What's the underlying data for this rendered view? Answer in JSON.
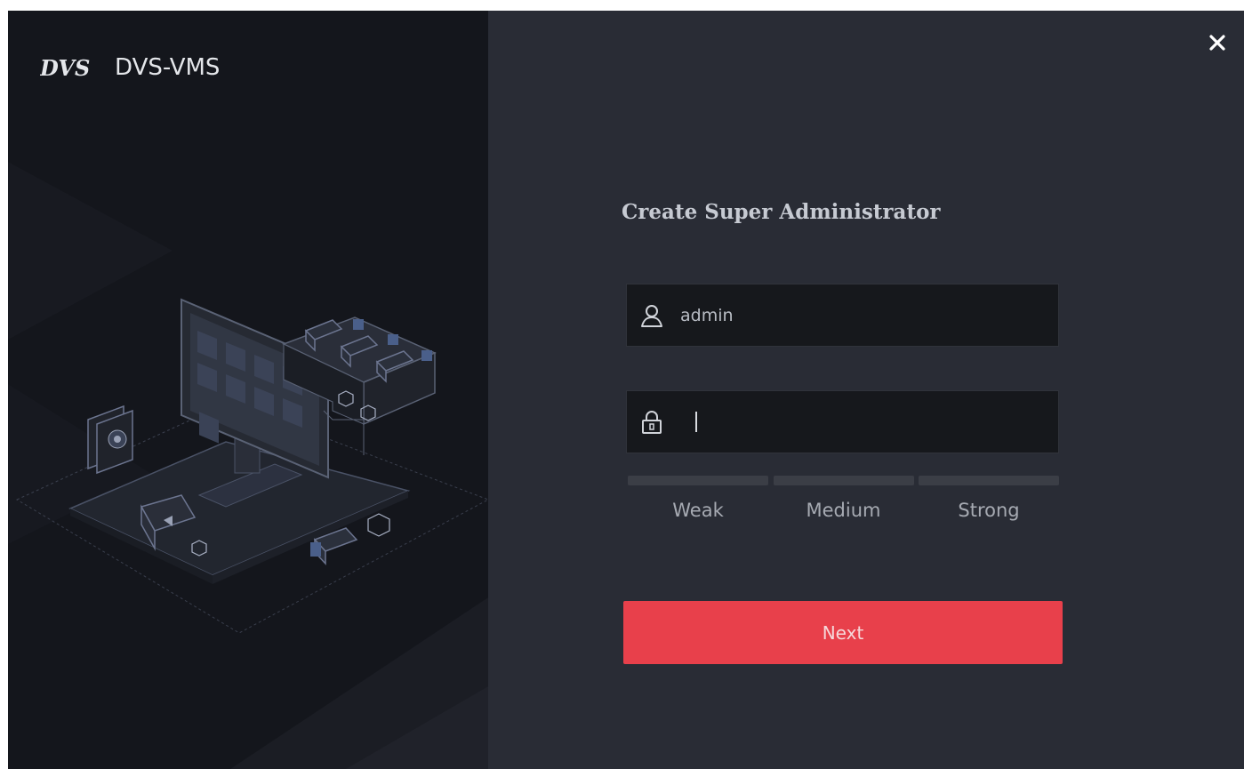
{
  "app": {
    "logo_icon": "dvs-logo-icon",
    "name": "DVS-VMS",
    "illustration": "video-surveillance-illustration"
  },
  "window": {
    "close_icon": "close-icon"
  },
  "form": {
    "title": "Create Super Administrator",
    "username": {
      "icon": "user-icon",
      "value": "admin",
      "placeholder": ""
    },
    "password": {
      "icon": "lock-icon",
      "value": "",
      "placeholder": ""
    },
    "strength": {
      "labels": [
        "Weak",
        "Medium",
        "Strong"
      ],
      "level": 0
    },
    "next_label": "Next"
  },
  "colors": {
    "accent": "#e8404b",
    "panel_dark": "#14161c",
    "panel_main": "#292c35"
  }
}
